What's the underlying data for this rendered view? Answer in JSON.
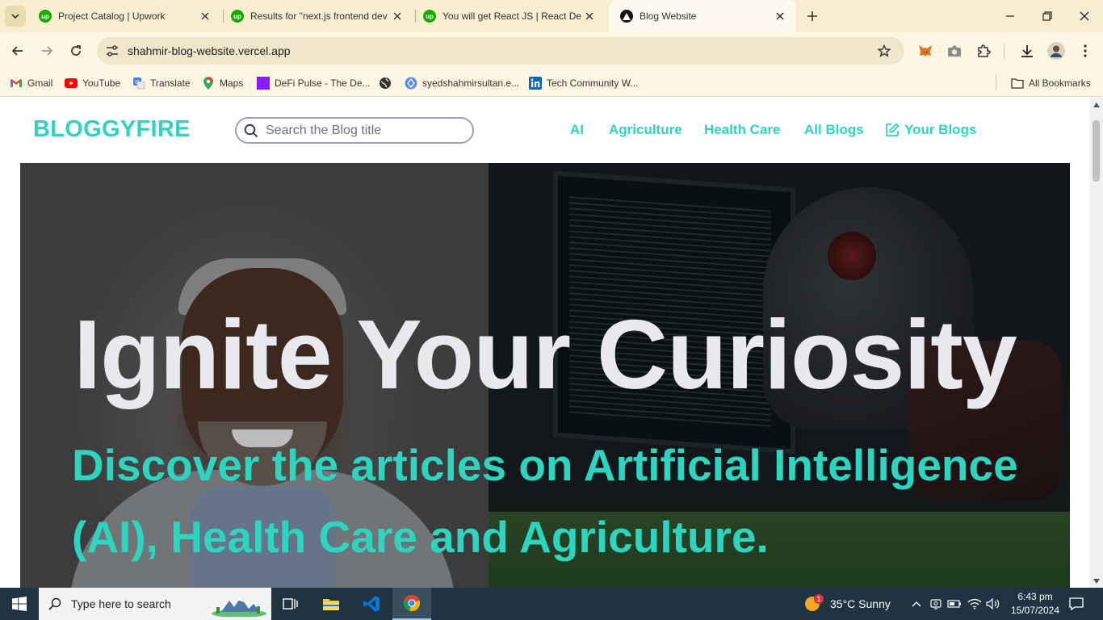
{
  "browser": {
    "tabs": [
      {
        "title": "Project Catalog | Upwork",
        "favicon": "upwork-icon"
      },
      {
        "title": "Results for \"next.js frontend dev",
        "favicon": "upwork-icon"
      },
      {
        "title": "You will get React JS | React Dev",
        "favicon": "upwork-icon"
      },
      {
        "title": "Blog Website",
        "favicon": "vercel-icon",
        "active": true
      }
    ],
    "url": "shahmir-blog-website.vercel.app",
    "bookmarks": [
      {
        "label": "Gmail",
        "icon": "gmail-icon"
      },
      {
        "label": "YouTube",
        "icon": "youtube-icon"
      },
      {
        "label": "Translate",
        "icon": "translate-icon"
      },
      {
        "label": "Maps",
        "icon": "maps-icon"
      },
      {
        "label": "DeFi Pulse - The De...",
        "icon": "defi-icon"
      },
      {
        "label": "",
        "icon": "globe-icon"
      },
      {
        "label": "syedshahmirsultan.e...",
        "icon": "site-icon"
      },
      {
        "label": "Tech Community W...",
        "icon": "linkedin-icon"
      }
    ],
    "all_bookmarks": "All Bookmarks"
  },
  "site": {
    "logo": "BLOGGYFIRE",
    "search_placeholder": "Search the Blog title",
    "nav": [
      "AI",
      "Agriculture",
      "Health Care",
      "All Blogs",
      "Your Blogs"
    ],
    "hero_title": "Ignite Your Curiosity",
    "hero_subtitle": "Discover the articles on Artificial Intelligence (AI), Health Care and Agriculture.",
    "accent_color": "#2dd4bf"
  },
  "taskbar": {
    "search_text": "Type here to search",
    "weather": "35°C  Sunny",
    "weather_badge": "1",
    "time": "6:43 pm",
    "date": "15/07/2024"
  }
}
